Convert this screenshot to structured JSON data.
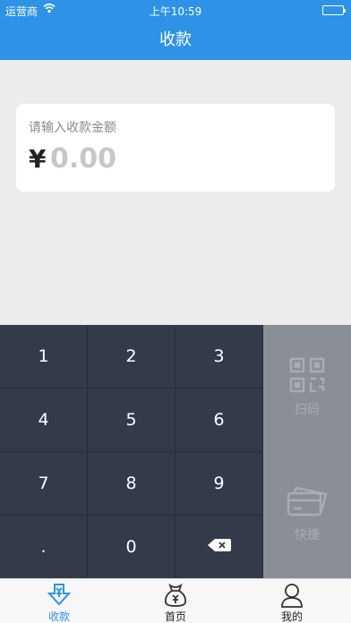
{
  "status_bar": {
    "carrier": "运营商",
    "time": "上午10:59",
    "battery_level": 1.0
  },
  "nav": {
    "title": "收款"
  },
  "amount": {
    "hint": "请输入收款金额",
    "currency": "¥",
    "value": "0.00"
  },
  "keypad": {
    "keys": [
      "1",
      "2",
      "3",
      "4",
      "5",
      "6",
      "7",
      "8",
      "9",
      ".",
      "0"
    ],
    "delete_icon": "backspace-icon"
  },
  "side_panel": {
    "scan_label": "扫码",
    "scan_icon": "qrcode-icon",
    "quick_label": "快捷",
    "quick_icon": "card-icon"
  },
  "tab_bar": {
    "tabs": [
      {
        "label": "收款",
        "icon": "download-icon",
        "active": true
      },
      {
        "label": "首页",
        "icon": "money-bag-icon",
        "active": false
      },
      {
        "label": "我的",
        "icon": "user-icon",
        "active": false
      }
    ]
  },
  "colors": {
    "accent": "#2e93e6",
    "keypad": "#333a4a",
    "side_panel": "#8a8e97",
    "page_bg": "#ececec"
  }
}
